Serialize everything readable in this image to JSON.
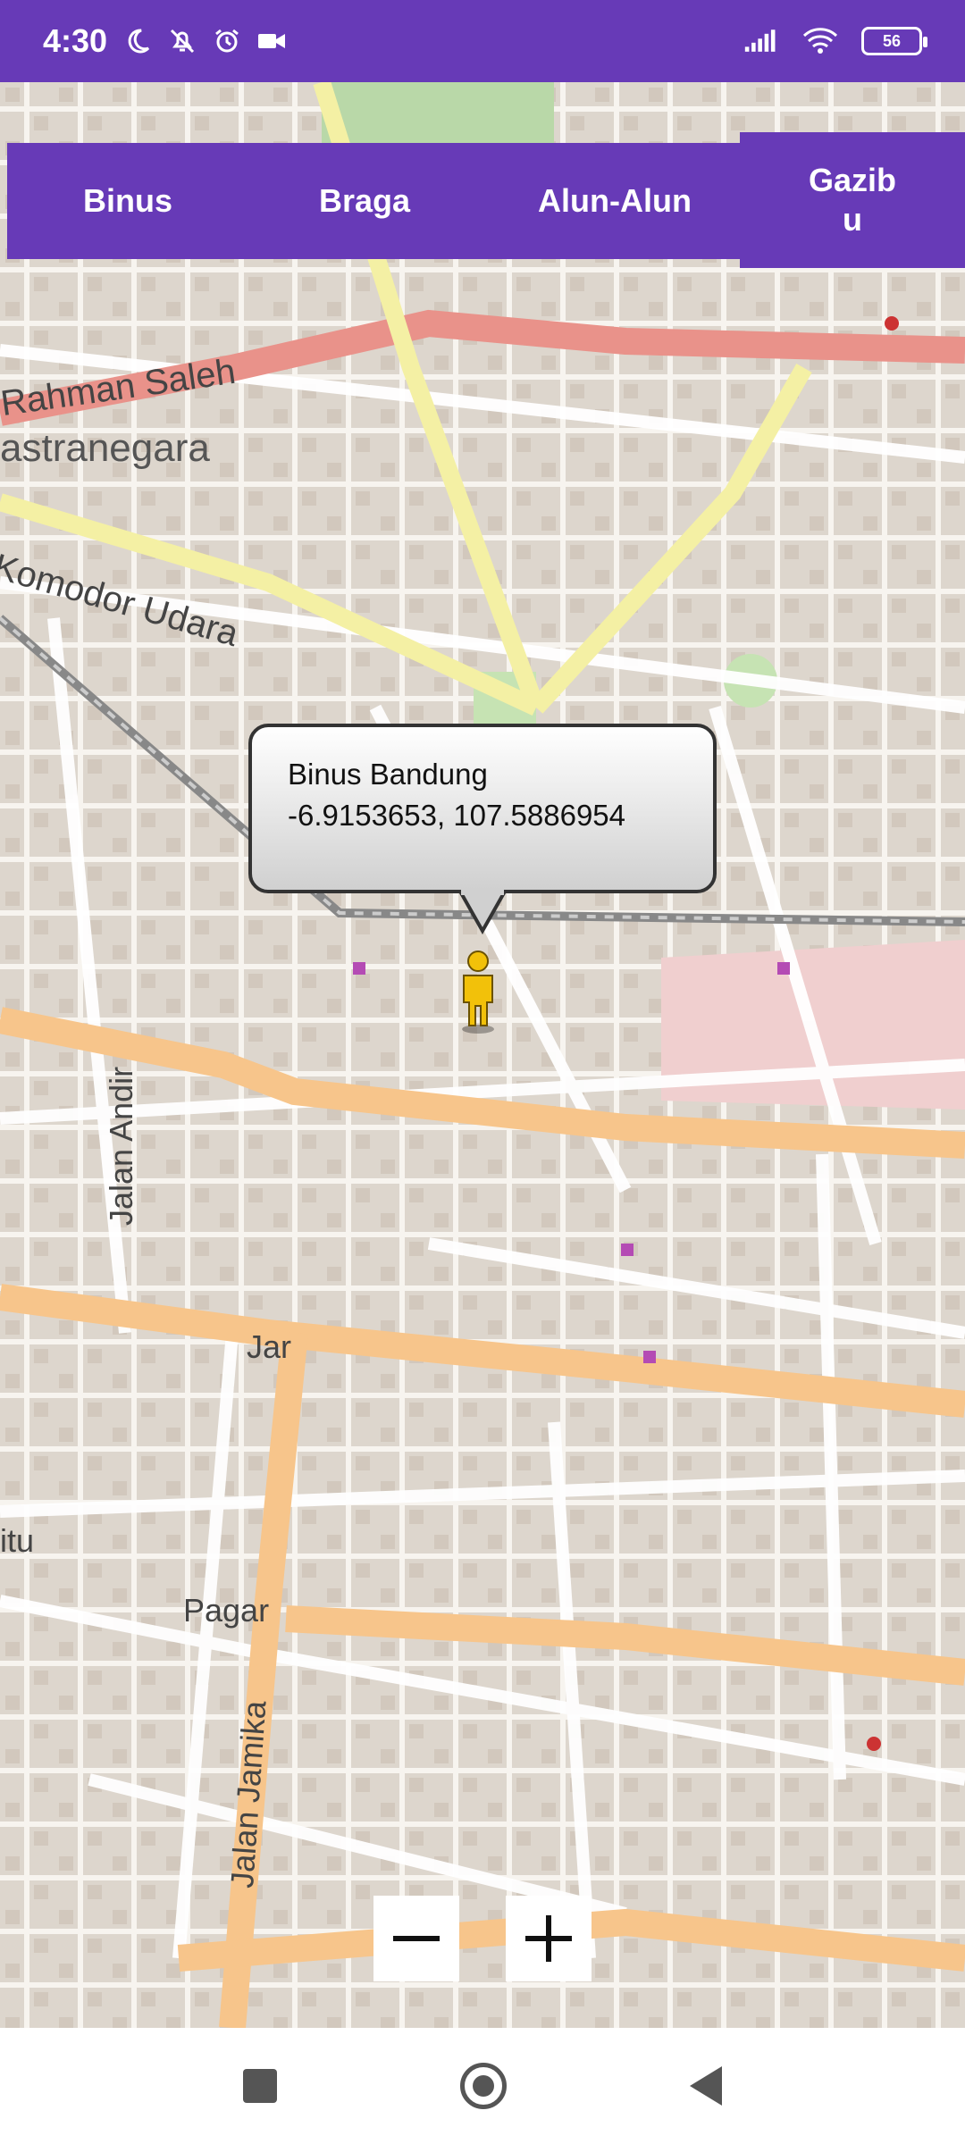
{
  "status_bar": {
    "time": "4:30",
    "battery": "56",
    "icons": [
      "moon-icon",
      "bell-off-icon",
      "alarm-icon",
      "video-icon",
      "signal-icon",
      "wifi-icon",
      "battery-icon"
    ]
  },
  "nav_buttons": [
    {
      "label": "Binus"
    },
    {
      "label": "Braga"
    },
    {
      "label": "Alun-Alun"
    },
    {
      "label": "Gazibu"
    }
  ],
  "map": {
    "labels": [
      "Rahman Saleh",
      "astranegara",
      "Komodor Udara",
      "Jalan Andir",
      "Jar",
      "Pagar",
      "Jalan Jamika",
      "itu"
    ],
    "marker": {
      "title": "Binus Bandung",
      "coords": "-6.9153653, 107.5886954"
    }
  },
  "zoom": {
    "out_label": "−",
    "in_label": "+"
  },
  "colors": {
    "accent": "#673ab7",
    "major_road": "#f7c58b",
    "trunk_road": "#e9928a",
    "secondary_road": "#f4f0a4"
  }
}
